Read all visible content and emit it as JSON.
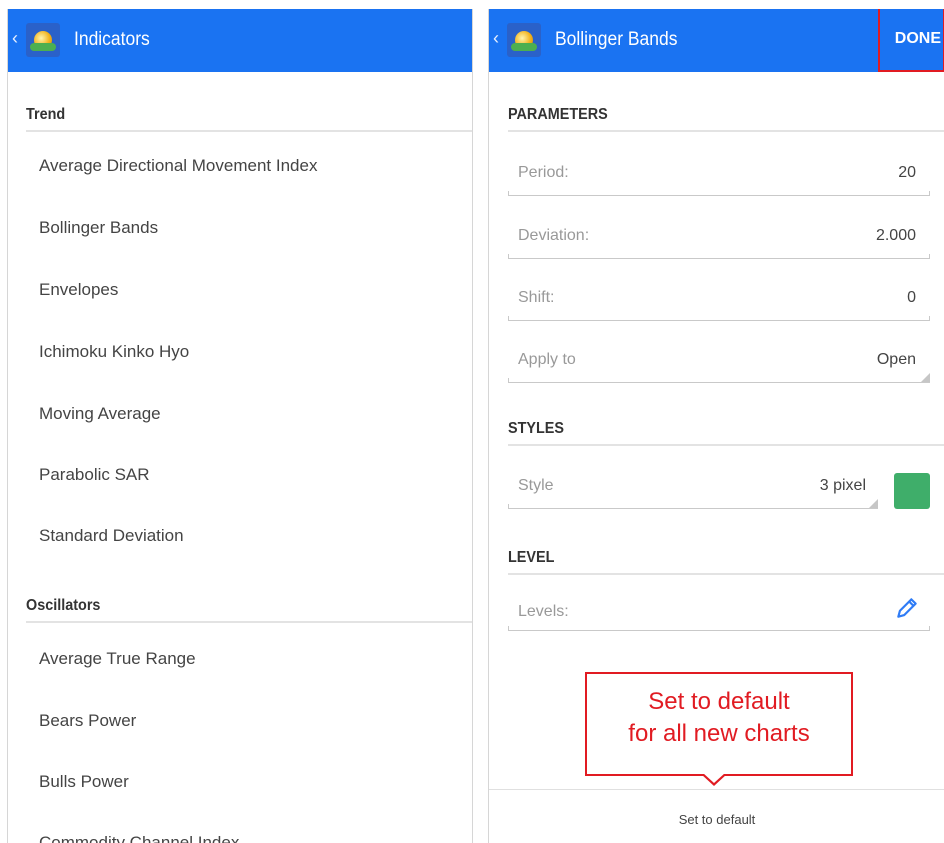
{
  "left": {
    "title": "Indicators",
    "sections": [
      {
        "heading": "Trend",
        "items": [
          "Average Directional Movement Index",
          "Bollinger Bands",
          "Envelopes",
          "Ichimoku Kinko Hyo",
          "Moving Average",
          "Parabolic SAR",
          "Standard Deviation"
        ]
      },
      {
        "heading": "Oscillators",
        "items": [
          "Average True Range",
          "Bears Power",
          "Bulls Power",
          "Commodity Channel Index"
        ]
      }
    ]
  },
  "right": {
    "title": "Bollinger Bands",
    "done_label": "DONE",
    "parameters": {
      "heading": "PARAMETERS",
      "period": {
        "label": "Period:",
        "value": "20"
      },
      "deviation": {
        "label": "Deviation:",
        "value": "2.000"
      },
      "shift": {
        "label": "Shift:",
        "value": "0"
      },
      "apply_to": {
        "label": "Apply to",
        "value": "Open"
      }
    },
    "styles": {
      "heading": "STYLES",
      "style": {
        "label": "Style",
        "value": "3 pixel",
        "color": "#3fae6a"
      }
    },
    "level": {
      "heading": "LEVEL",
      "levels": {
        "label": "Levels:"
      }
    },
    "callout": {
      "line1": "Set to default",
      "line2": "for all new charts"
    },
    "footer_button": "Set to default"
  },
  "colors": {
    "appbar": "#1a73f2",
    "highlight": "#e11b22",
    "swatch": "#3fae6a",
    "pencil": "#2f7cf6"
  },
  "icons": {
    "back": "chevron-left-icon",
    "logo": "metatrader-logo-icon",
    "edit": "pencil-icon"
  }
}
